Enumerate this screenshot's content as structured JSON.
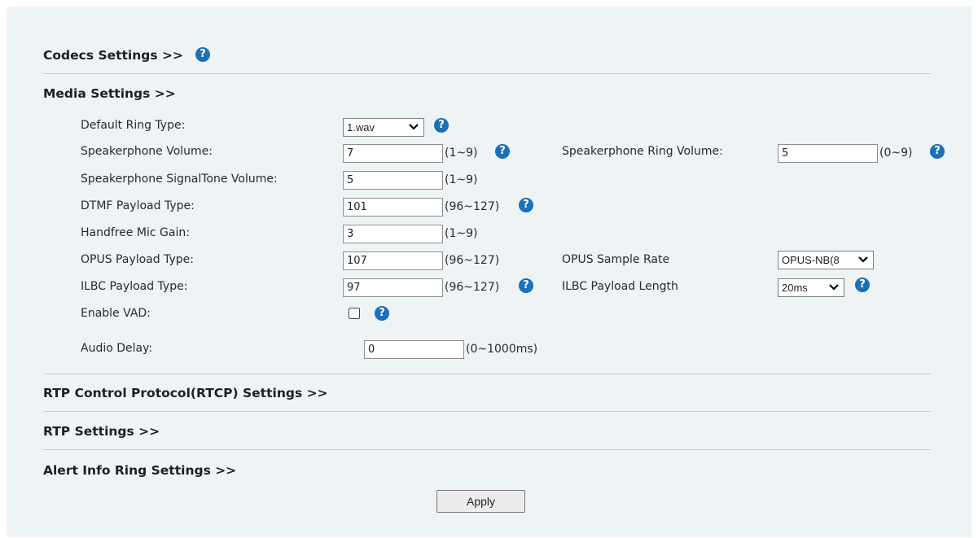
{
  "sections": {
    "codecs": "Codecs Settings >>",
    "media": "Media Settings >>",
    "rtcp": "RTP Control Protocol(RTCP) Settings >>",
    "rtp": "RTP Settings >>",
    "alert": "Alert Info Ring Settings >>"
  },
  "media": {
    "default_ring_type": {
      "label": "Default Ring Type:",
      "value": "1.wav"
    },
    "speakerphone_volume": {
      "label": "Speakerphone Volume:",
      "value": "7",
      "range": "(1~9)"
    },
    "speakerphone_ring_volume": {
      "label": "Speakerphone Ring Volume:",
      "value": "5",
      "range": "(0~9)"
    },
    "signaltone_volume": {
      "label": "Speakerphone SignalTone Volume:",
      "value": "5",
      "range": "(1~9)"
    },
    "dtmf_payload_type": {
      "label": "DTMF Payload Type:",
      "value": "101",
      "range": "(96~127)"
    },
    "handfree_mic_gain": {
      "label": "Handfree Mic Gain:",
      "value": "3",
      "range": "(1~9)"
    },
    "opus_payload_type": {
      "label": "OPUS Payload Type:",
      "value": "107",
      "range": "(96~127)"
    },
    "opus_sample_rate": {
      "label": "OPUS Sample Rate",
      "value": "OPUS-NB(8"
    },
    "ilbc_payload_type": {
      "label": "ILBC Payload Type:",
      "value": "97",
      "range": "(96~127)"
    },
    "ilbc_payload_length": {
      "label": "ILBC Payload Length",
      "value": "20ms"
    },
    "enable_vad": {
      "label": "Enable VAD:",
      "checked": false
    },
    "audio_delay": {
      "label": "Audio Delay:",
      "value": "0",
      "range": "(0~1000ms)"
    }
  },
  "help_glyph": "?",
  "apply_label": "Apply",
  "colors": {
    "panel_bg": "#eef3f6",
    "help_icon": "#1d6fb8",
    "separator": "#c8cdd1"
  }
}
